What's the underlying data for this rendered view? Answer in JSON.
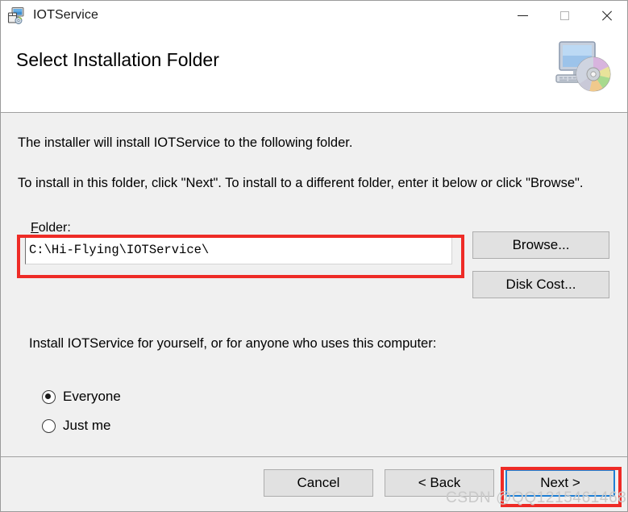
{
  "window": {
    "title": "IOTService",
    "app_icon": "installer-package-icon"
  },
  "caption": {
    "minimize": "minimize-icon",
    "maximize": "maximize-icon",
    "close": "close-icon"
  },
  "banner": {
    "heading": "Select Installation Folder",
    "icon": "computer-disc-icon"
  },
  "main": {
    "intro_line1": "The installer will install IOTService to the following folder.",
    "intro_line2": "To install in this folder, click \"Next\". To install to a different folder, enter it below or click \"Browse\".",
    "folder_label_prefix": "F",
    "folder_label_rest": "older:",
    "folder_value": "C:\\Hi-Flying\\IOTService\\",
    "browse_label": "Browse...",
    "disk_cost_label": "Disk Cost...",
    "share_prompt": "Install IOTService for yourself, or for anyone who uses this computer:",
    "radio_everyone": "Everyone",
    "radio_just_me": "Just me",
    "selected_scope": "Everyone"
  },
  "footer": {
    "cancel_label": "Cancel",
    "back_label": "< Back",
    "next_label": "Next >"
  },
  "watermark": {
    "text": "CSDN @QQ1215461468"
  },
  "colors": {
    "annotation_red": "#ee2b26",
    "focus_blue": "#1e7fd4",
    "body_grey": "#f0f0f0",
    "button_face": "#e1e1e1"
  }
}
